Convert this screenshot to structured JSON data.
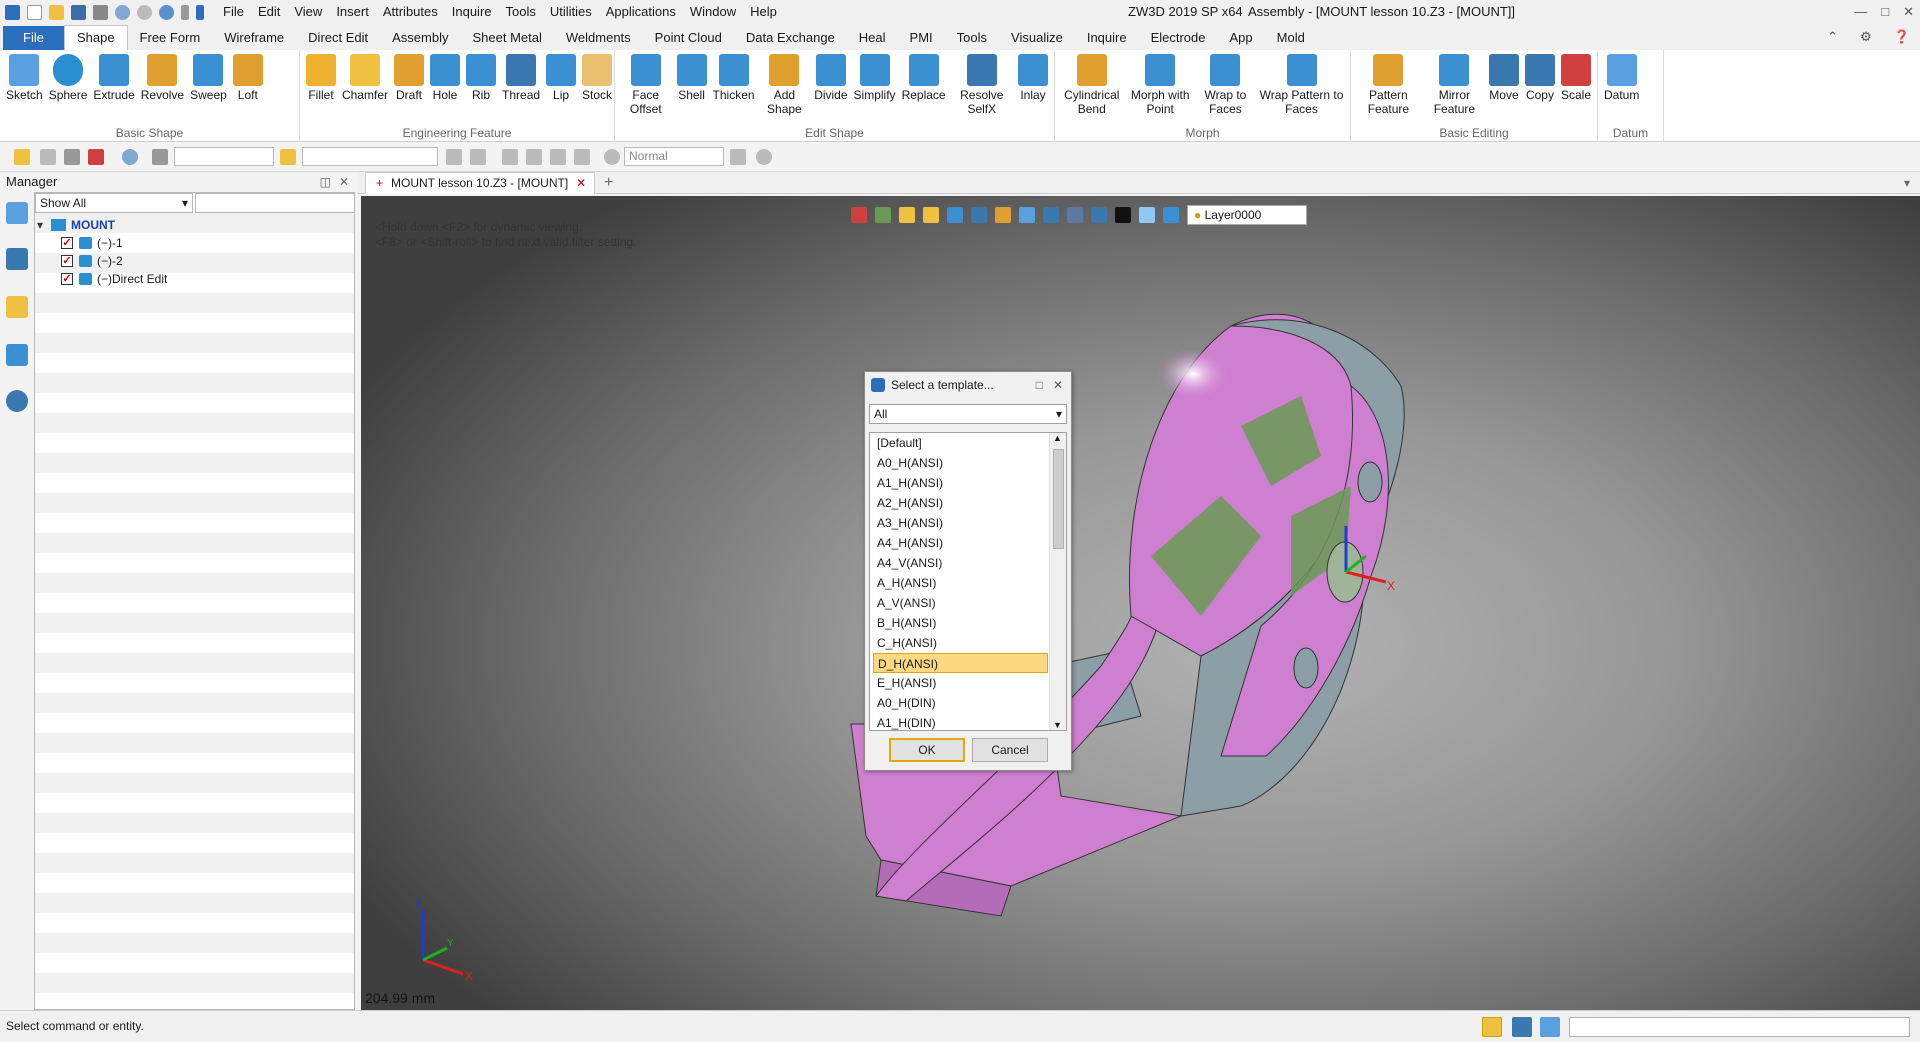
{
  "title_bar": {
    "app": "ZW3D 2019 SP x64",
    "document": "Assembly - [MOUNT lesson 10.Z3 - [MOUNT]]",
    "menu": [
      "File",
      "Edit",
      "View",
      "Insert",
      "Attributes",
      "Inquire",
      "Tools",
      "Utilities",
      "Applications",
      "Window",
      "Help"
    ],
    "qat_icons": [
      "app-logo-icon",
      "new-icon",
      "open-icon",
      "save-icon",
      "print-icon",
      "undo-icon",
      "redo-icon",
      "refresh-icon",
      "dropdown-icon",
      "back-icon"
    ],
    "window_controls": [
      "—",
      "□",
      "✕"
    ]
  },
  "ribbon_tabs": [
    "File",
    "Shape",
    "Free Form",
    "Wireframe",
    "Direct Edit",
    "Assembly",
    "Sheet Metal",
    "Weldments",
    "Point Cloud",
    "Data Exchange",
    "Heal",
    "PMI",
    "Tools",
    "Visualize",
    "Inquire",
    "Electrode",
    "App",
    "Mold"
  ],
  "active_tab": "Shape",
  "ribbon_groups": [
    {
      "label": "Basic Shape",
      "buttons": [
        "Sketch",
        "Sphere",
        "Extrude",
        "Revolve",
        "Sweep",
        "Loft"
      ]
    },
    {
      "label": "Engineering Feature",
      "buttons": [
        "Fillet",
        "Chamfer",
        "Draft",
        "Hole",
        "Rib",
        "Thread",
        "Lip",
        "Stock"
      ]
    },
    {
      "label": "Edit Shape",
      "buttons": [
        "Face Offset",
        "Shell",
        "Thicken",
        "Add Shape",
        "Divide",
        "Simplify",
        "Replace",
        "Resolve SelfX",
        "Inlay"
      ]
    },
    {
      "label": "Morph",
      "buttons": [
        "Cylindrical Bend",
        "Morph with Point",
        "Wrap to Faces",
        "Wrap Pattern to Faces"
      ]
    },
    {
      "label": "Basic Editing",
      "buttons": [
        "Pattern Feature",
        "Mirror Feature",
        "Move",
        "Copy",
        "Scale"
      ]
    },
    {
      "label": "Datum",
      "buttons": [
        "Datum"
      ]
    }
  ],
  "toolbar": {
    "render_mode": "Normal"
  },
  "manager": {
    "title": "Manager",
    "filter": "Show All",
    "tree": [
      {
        "label": "MOUNT",
        "checked": false
      },
      {
        "label": "(−)-1",
        "checked": true
      },
      {
        "label": "(−)-2",
        "checked": true
      },
      {
        "label": "(−)Direct Edit",
        "checked": true
      }
    ]
  },
  "doc_tab": {
    "label": "MOUNT lesson 10.Z3 - [MOUNT]"
  },
  "viewport": {
    "hint1": "<Hold down <F2> for dynamic viewing.",
    "hint2": "<F8> or <Shift-roll> to find next valid filter setting.",
    "layer": "Layer0000",
    "measurement": "204.99 mm",
    "axis_labels": {
      "x": "X",
      "y": "Y",
      "z": "Z"
    }
  },
  "dialog": {
    "title": "Select a template...",
    "filter": "All",
    "items": [
      "[Default]",
      "A0_H(ANSI)",
      "A1_H(ANSI)",
      "A2_H(ANSI)",
      "A3_H(ANSI)",
      "A4_H(ANSI)",
      "A4_V(ANSI)",
      "A_H(ANSI)",
      "A_V(ANSI)",
      "B_H(ANSI)",
      "C_H(ANSI)",
      "D_H(ANSI)",
      "E_H(ANSI)",
      "A0_H(DIN)",
      "A1_H(DIN)"
    ],
    "selected": "D_H(ANSI)",
    "ok": "OK",
    "cancel": "Cancel"
  },
  "status": {
    "text": "Select command or entity."
  },
  "colors": {
    "file_tab": "#2a6fbd",
    "selection": "#fcd881",
    "part_magenta": "#cf7fd0",
    "part_green": "#6a9a55",
    "part_grey": "#8c9ea6"
  }
}
